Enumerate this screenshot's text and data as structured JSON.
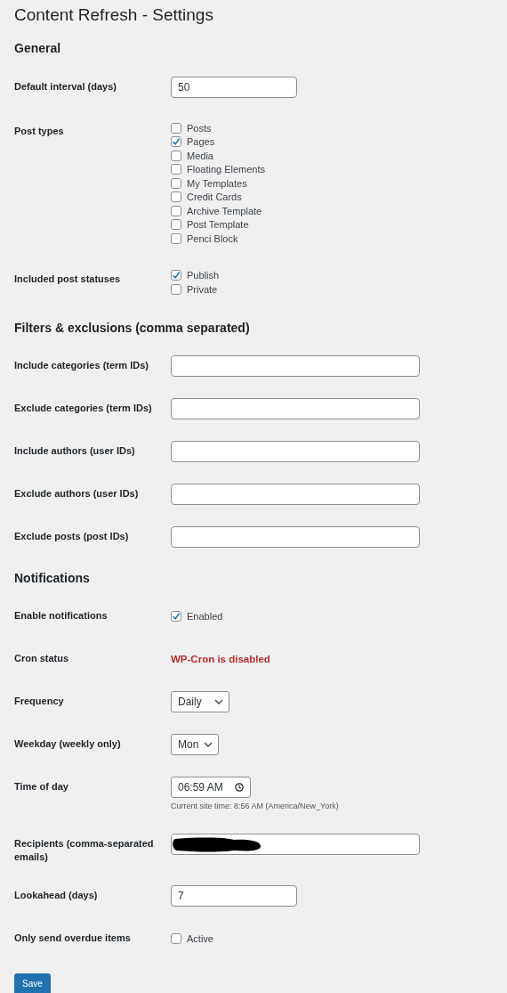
{
  "title": "Content Refresh - Settings",
  "sections": [
    {
      "heading": "General",
      "rows": [
        {
          "label": "Default interval (days)",
          "kind": "number",
          "value": "50"
        },
        {
          "label": "Post types",
          "kind": "checklist",
          "options": [
            {
              "label": "Posts",
              "checked": false
            },
            {
              "label": "Pages",
              "checked": true
            },
            {
              "label": "Media",
              "checked": false
            },
            {
              "label": "Floating Elements",
              "checked": false
            },
            {
              "label": "My Templates",
              "checked": false
            },
            {
              "label": "Credit Cards",
              "checked": false
            },
            {
              "label": "Archive Template",
              "checked": false
            },
            {
              "label": "Post Template",
              "checked": false
            },
            {
              "label": "Penci Block",
              "checked": false
            }
          ]
        },
        {
          "label": "Included post statuses",
          "kind": "checklist",
          "options": [
            {
              "label": "Publish",
              "checked": true
            },
            {
              "label": "Private",
              "checked": false
            }
          ]
        }
      ]
    },
    {
      "heading": "Filters & exclusions (comma separated)",
      "rows": [
        {
          "label": "Include categories (term IDs)",
          "kind": "text"
        },
        {
          "label": "Exclude categories (term IDs)",
          "kind": "text"
        },
        {
          "label": "Include authors (user IDs)",
          "kind": "text"
        },
        {
          "label": "Exclude authors (user IDs)",
          "kind": "text"
        },
        {
          "label": "Exclude posts (post IDs)",
          "kind": "text"
        }
      ]
    },
    {
      "heading": "Notifications",
      "rows": [
        {
          "label": "Enable notifications",
          "kind": "checklist",
          "options": [
            {
              "label": "Enabled",
              "checked": true
            }
          ]
        },
        {
          "label": "Cron status",
          "kind": "status",
          "text": "WP-Cron is disabled",
          "color": "#b32d2e"
        },
        {
          "label": "Frequency",
          "kind": "select",
          "value": "Daily"
        },
        {
          "label": "Weekday (weekly only)",
          "kind": "select",
          "value": "Mon"
        },
        {
          "label": "Time of day",
          "kind": "time",
          "value": "06:59 AM",
          "hint": "Current site time: 8:56 AM (America/New_York)"
        },
        {
          "label": "Recipients (comma-separated emails)",
          "kind": "text",
          "redacted": true
        },
        {
          "label": "Lookahead (days)",
          "kind": "number",
          "value": "7"
        },
        {
          "label": "Only send overdue items",
          "kind": "checklist",
          "options": [
            {
              "label": "Active",
              "checked": false
            }
          ]
        }
      ]
    }
  ],
  "save_button": "Save"
}
